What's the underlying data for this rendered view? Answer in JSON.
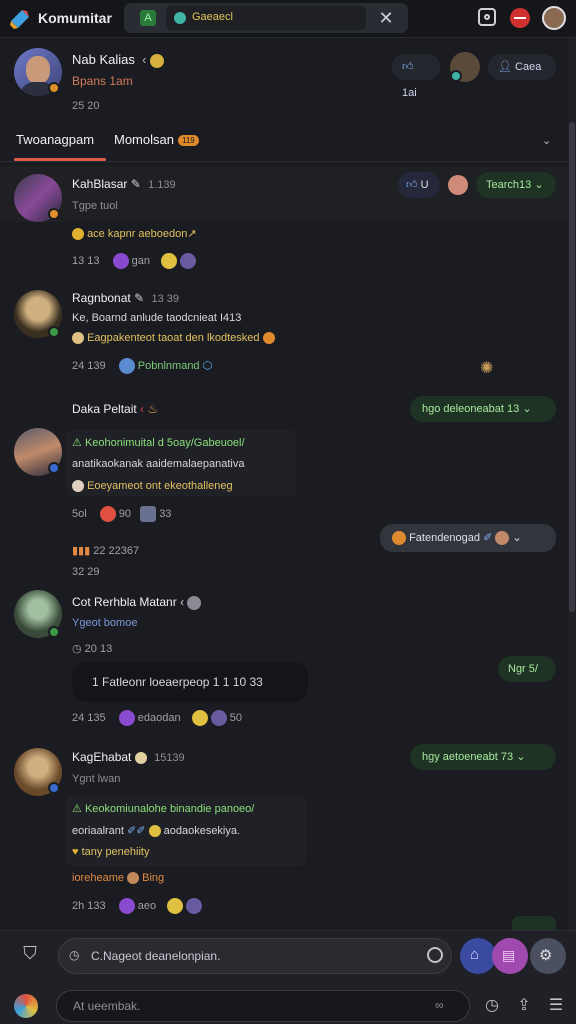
{
  "app": {
    "title": "Komumitar",
    "tab_label": "Gaeaecl",
    "tab_badge": "A"
  },
  "profile": {
    "name": "Nab Kalias",
    "sub": "Bpans 1am",
    "stat": "25 20",
    "chip_left": "1ai",
    "chip_right": "Caea"
  },
  "tabs": {
    "primary": "Twoanagpam",
    "secondary": "Momolsan",
    "secondary_count": "119"
  },
  "comments": [
    {
      "name": "KahBlasar",
      "time": "1.139",
      "sub": "Tgpe tuol",
      "line": "ace kapnr aeboedon",
      "meta": "13 13",
      "reaction_text": "gan",
      "chip_label": "U",
      "action": "Tearch13"
    },
    {
      "name": "Ragnbonat",
      "time": "13 39",
      "sub": "Ke, Boarnd anlude taodcnieat I413",
      "line": "Eagpakenteot taoat den lkodtesked",
      "meta": "24 139",
      "link": "Pobnlnmand"
    },
    {
      "name": "Daka Peltait",
      "action": "hgo deleoneabat 13",
      "lines": [
        "Keohonimuital d 5oay/Gabeuoel/",
        "anatikaokanak aaidemalaepanativa",
        "Eoeyameot ont ekeothalleneg"
      ],
      "meta": "5ol",
      "meta_count": "90",
      "meta_count2": "33",
      "pill_label": "Fatendenogad",
      "orange_line": "22 22367",
      "stat": "32 29"
    },
    {
      "name": "Cot Rerhbla Matanr",
      "sub": "Ygeot bomoe",
      "meta": "20 13",
      "bubble": "1 Fatleonr loeaerpeop  1 1 10 33",
      "tag": "Ngr 5/",
      "meta2": "24 135",
      "reaction_text": "edaodan",
      "reaction_count": "50"
    },
    {
      "name": "KagEhabat",
      "time": "15139",
      "sub": "Ygnt lwan",
      "action": "hgy aetoeneabt 73",
      "lines": [
        "Keokomiunalohe binandie panoeo/",
        "eoriaalrant",
        "tany penehiity"
      ],
      "blue_text": "aodaokesekiya.",
      "orange_line": "ioreheame",
      "orange_tail": "Bing",
      "meta": "2h 133",
      "reaction_text": "aeo"
    }
  ],
  "composer": {
    "placeholder": "C.Nageot deanelonpian.",
    "second_placeholder": "At ueembak."
  }
}
